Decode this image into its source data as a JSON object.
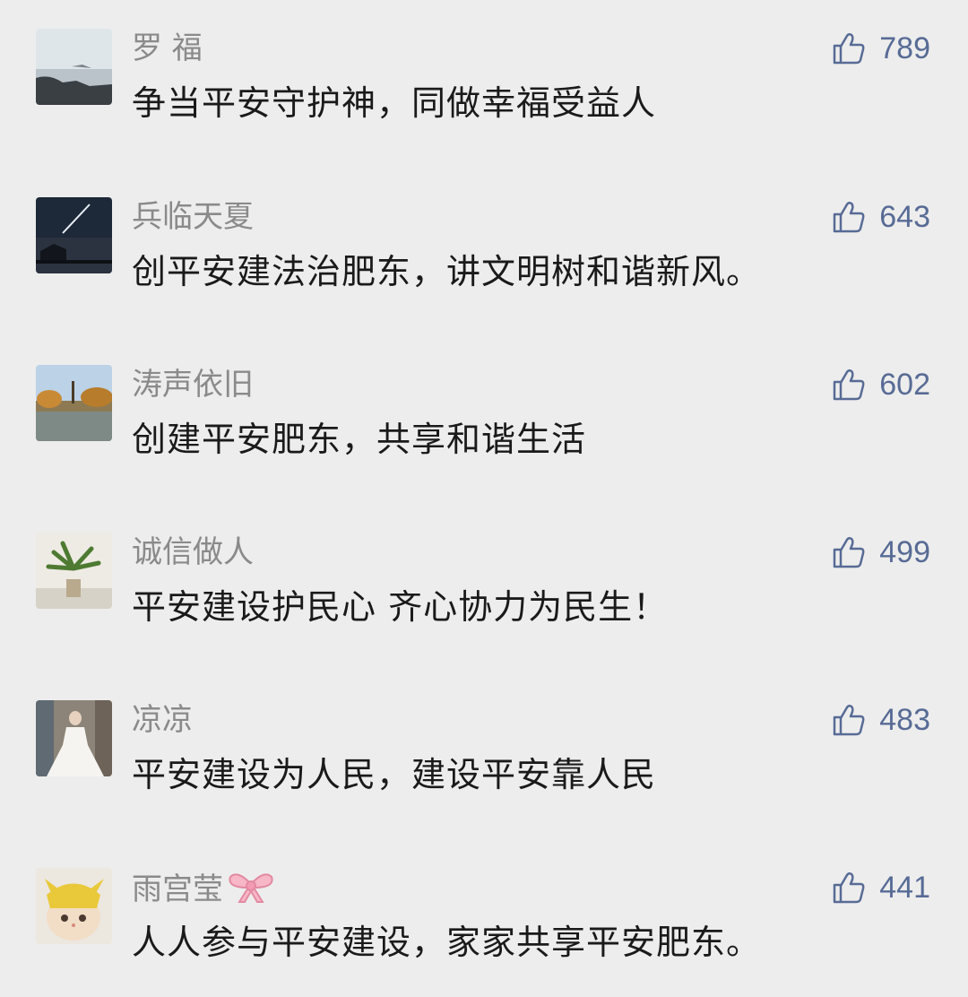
{
  "comments": [
    {
      "name": "罗 福",
      "text": "争当平安守护神，同做幸福受益人",
      "likes": "789"
    },
    {
      "name": "兵临天夏",
      "text": "创平安建法治肥东，讲文明树和谐新风。",
      "likes": "643"
    },
    {
      "name": "涛声依旧",
      "text": "创建平安肥东，共享和谐生活",
      "likes": "602"
    },
    {
      "name": "诚信做人",
      "text": "平安建设护民心  齐心协力为民生！",
      "likes": "499"
    },
    {
      "name": "凉凉",
      "text": "平安建设为人民，建设平安靠人民",
      "likes": "483"
    },
    {
      "name": "雨宫莹",
      "text": "人人参与平安建设，家家共享平安肥东。",
      "likes": "441"
    }
  ],
  "icons": {
    "like": "thumbs-up-icon",
    "bow": "ribbon-bow-icon"
  },
  "colors": {
    "background": "#ededed",
    "name": "#8a8a8a",
    "text": "#1a1a1a",
    "like": "#576b95"
  }
}
